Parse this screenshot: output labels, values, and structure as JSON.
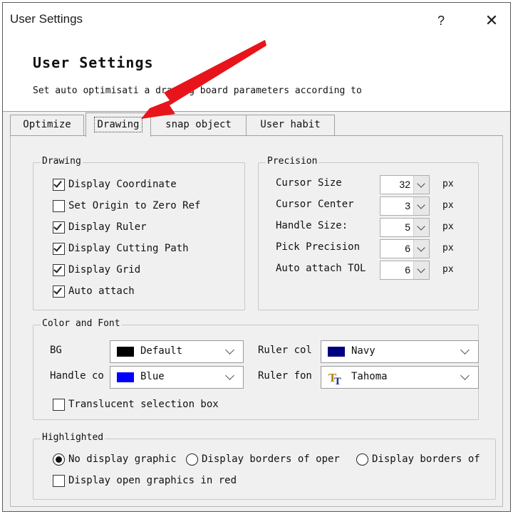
{
  "window": {
    "title": "User Settings",
    "help_label": "?",
    "close_label": "✕"
  },
  "header": {
    "title": "User Settings",
    "description": "Set auto optimisati   a drawing board parameters according to"
  },
  "tabs": [
    {
      "label": "Optimize",
      "active": false
    },
    {
      "label": "Drawing",
      "active": true
    },
    {
      "label": "snap object",
      "active": false
    },
    {
      "label": "User habit",
      "active": false
    }
  ],
  "drawing_group": {
    "title": "Drawing",
    "items": [
      {
        "label": "Display Coordinate",
        "checked": true
      },
      {
        "label": "Set Origin to Zero Ref",
        "checked": false
      },
      {
        "label": "Display Ruler",
        "checked": true
      },
      {
        "label": "Display Cutting Path",
        "checked": true
      },
      {
        "label": "Display Grid",
        "checked": true
      },
      {
        "label": "Auto attach",
        "checked": true
      }
    ]
  },
  "precision_group": {
    "title": "Precision",
    "items": [
      {
        "label": "Cursor Size",
        "value": "32",
        "unit": "px"
      },
      {
        "label": "Cursor Center",
        "value": "3",
        "unit": "px"
      },
      {
        "label": "Handle Size:",
        "value": "5",
        "unit": "px"
      },
      {
        "label": "Pick Precision",
        "value": "6",
        "unit": "px"
      },
      {
        "label": "Auto attach TOL",
        "value": "6",
        "unit": "px"
      }
    ]
  },
  "color_font_group": {
    "title": "Color and Font",
    "bg_label": "BG",
    "bg_value": "Default",
    "bg_color": "#000000",
    "handle_label": "Handle co",
    "handle_value": "Blue",
    "handle_color": "#0000ff",
    "ruler_color_label": "Ruler col",
    "ruler_color_value": "Navy",
    "ruler_color": "#000080",
    "ruler_font_label": "Ruler fon",
    "ruler_font_value": "Tahoma",
    "font_icon": "font-type-icon",
    "translucent_label": "Translucent selection box",
    "translucent_checked": false
  },
  "highlighted_group": {
    "title": "Highlighted",
    "radio_options": [
      {
        "label": "No display graphic",
        "selected": true
      },
      {
        "label": "Display borders of oper",
        "selected": false
      },
      {
        "label": "Display borders of",
        "selected": false
      }
    ],
    "red_open_label": "Display open graphics in red",
    "red_open_checked": false
  },
  "annotation": {
    "arrow_color": "#e8141b"
  }
}
